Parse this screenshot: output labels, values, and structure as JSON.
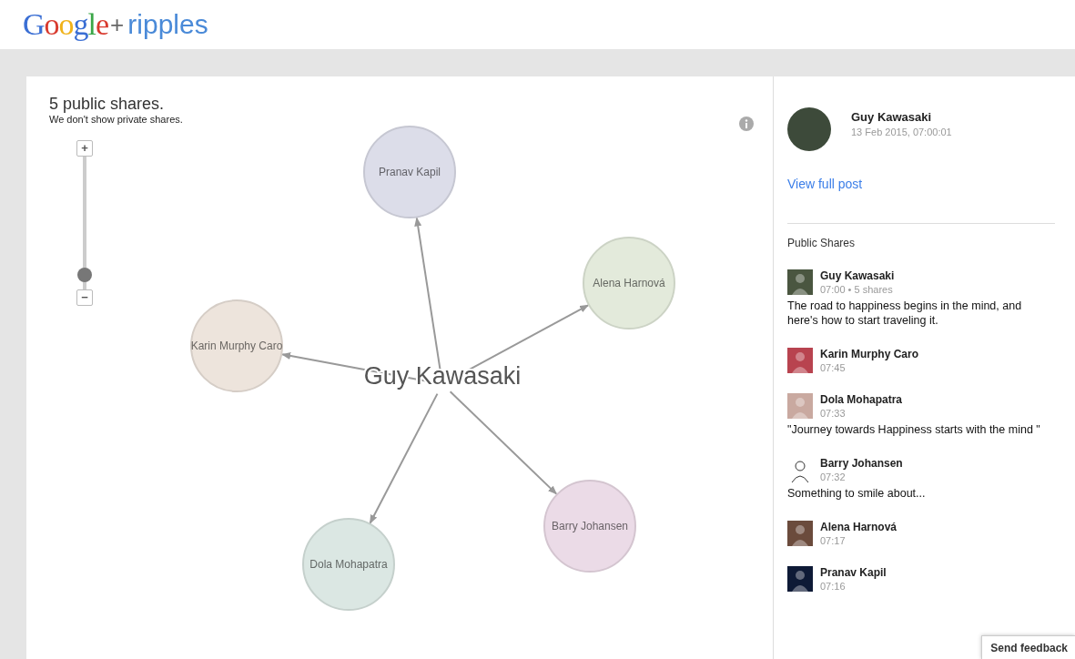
{
  "header": {
    "logo": "Google",
    "plus": "+",
    "product": "ripples"
  },
  "graph": {
    "title": "5 public shares.",
    "subtitle": "We don't show private shares.",
    "zoom": {
      "plus": "+",
      "minus": "−",
      "level": 0.06
    },
    "center": "Guy Kawasaki",
    "nodes": [
      {
        "name": "Pranav Kapil",
        "color": "#dcdde9"
      },
      {
        "name": "Alena Harnová",
        "color": "#e3eadb"
      },
      {
        "name": "Karin Murphy Caro",
        "color": "#ede4dc"
      },
      {
        "name": "Barry Johansen",
        "color": "#ebdbe7"
      },
      {
        "name": "Dola Mohapatra",
        "color": "#dbe7e3"
      }
    ]
  },
  "post": {
    "author": "Guy Kawasaki",
    "date": "13 Feb 2015, 07:00:01",
    "link": "View full post"
  },
  "public_shares": {
    "heading": "Public Shares",
    "items": [
      {
        "name": "Guy Kawasaki",
        "meta": "07:00 • 5 shares",
        "text": "The road to happiness begins in the mind, and here's how to start traveling it."
      },
      {
        "name": "Karin Murphy Caro",
        "meta": "07:45"
      },
      {
        "name": "Dola Mohapatra",
        "meta": "07:33",
        "text": "\"Journey towards Happiness starts with the mind \""
      },
      {
        "name": "Barry Johansen",
        "meta": "07:32",
        "text": "Something to smile about..."
      },
      {
        "name": "Alena Harnová",
        "meta": "07:17"
      },
      {
        "name": "Pranav Kapil",
        "meta": "07:16"
      }
    ]
  },
  "feedback": "Send feedback"
}
